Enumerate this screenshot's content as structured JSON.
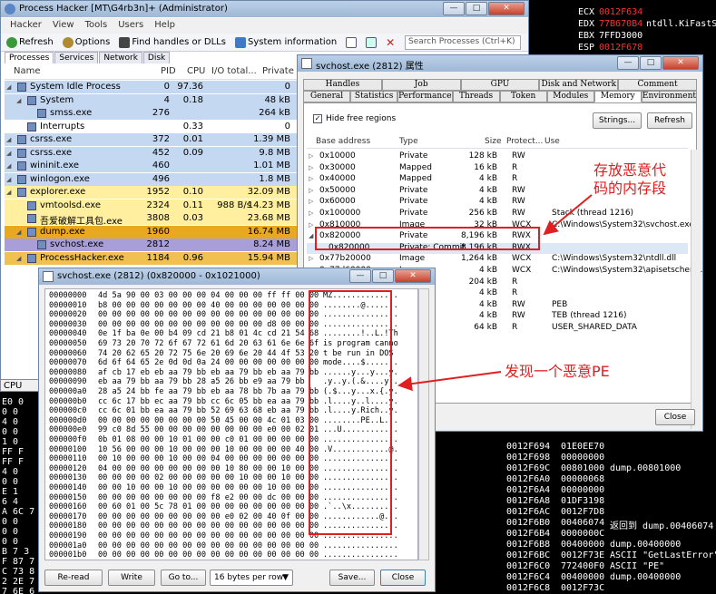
{
  "debugger": {
    "registers": [
      {
        "name": "ECX",
        "value": "0012F634",
        "note": ""
      },
      {
        "name": "EDX",
        "value": "77B670B4",
        "note": "ntdll.KiFastS"
      },
      {
        "name": "EBX",
        "value": "7FFD3000",
        "note": ""
      },
      {
        "name": "ESP",
        "value": "0012F678",
        "note": ""
      }
    ],
    "left_dump": [
      "E0 0",
      "0 0",
      "4 0",
      "0 0",
      "1 0",
      "FF F",
      "FF F",
      "4 0",
      "0 0",
      "E 1",
      "6 4",
      "A 6C 7",
      "0 0",
      "0 0",
      "0 0",
      "B 7 3",
      "F 87 7",
      "C 73 8",
      "2 2E 7",
      "7 6E 6",
      "2 7 5"
    ],
    "stack": [
      {
        "addr": "0012F694",
        "val": "01E0EE70",
        "comment": ""
      },
      {
        "addr": "0012F698",
        "val": "00000000",
        "comment": ""
      },
      {
        "addr": "0012F69C",
        "val": "00801000",
        "comment": "dump.00801000"
      },
      {
        "addr": "0012F6A0",
        "val": "00000068",
        "comment": ""
      },
      {
        "addr": "0012F6A4",
        "val": "00000000",
        "comment": ""
      },
      {
        "addr": "0012F6A8",
        "val": "01DF3198",
        "comment": ""
      },
      {
        "addr": "0012F6AC",
        "val": "0012F7D8",
        "comment": ""
      },
      {
        "addr": "0012F6B0",
        "val": "00406074",
        "comment": "返回到 dump.00406074"
      },
      {
        "addr": "0012F6B4",
        "val": "0000000C",
        "comment": ""
      },
      {
        "addr": "0012F6B8",
        "val": "00400000",
        "comment": "dump.00400000"
      },
      {
        "addr": "0012F6BC",
        "val": "0012F73E",
        "comment": "ASCII \"GetLastError\""
      },
      {
        "addr": "0012F6C0",
        "val": "772400F0",
        "comment": "ASCII \"PE\""
      },
      {
        "addr": "0012F6C4",
        "val": "00400000",
        "comment": "dump.00400000"
      },
      {
        "addr": "0012F6C8",
        "val": "0012F73C",
        "comment": ""
      }
    ]
  },
  "ph": {
    "title": "Process Hacker [MT\\G4rb3n]+ (Administrator)",
    "menu": [
      "Hacker",
      "View",
      "Tools",
      "Users",
      "Help"
    ],
    "toolbar": {
      "refresh": "Refresh",
      "options": "Options",
      "find": "Find handles or DLLs",
      "sysinfo": "System information"
    },
    "search_placeholder": "Search Processes (Ctrl+K)",
    "tabs": [
      "Processes",
      "Services",
      "Network",
      "Disk"
    ],
    "columns": {
      "name": "Name",
      "pid": "PID",
      "cpu": "CPU",
      "io": "I/O total...",
      "private": "Private ..."
    },
    "processes": [
      {
        "name": "System Idle Process",
        "pid": "0",
        "cpu": "97.36",
        "io": "",
        "private": "0",
        "indent": 0,
        "color": "#c4d8f2"
      },
      {
        "name": "System",
        "pid": "4",
        "cpu": "0.18",
        "io": "",
        "private": "48 kB",
        "indent": 1,
        "color": "#c4d8f2"
      },
      {
        "name": "smss.exe",
        "pid": "276",
        "cpu": "",
        "io": "",
        "private": "264 kB",
        "indent": 2,
        "color": "#c4d8f2"
      },
      {
        "name": "Interrupts",
        "pid": "",
        "cpu": "0.33",
        "io": "",
        "private": "0",
        "indent": 1,
        "color": "#ffffff"
      },
      {
        "name": "csrss.exe",
        "pid": "372",
        "cpu": "0.01",
        "io": "",
        "private": "1.39 MB",
        "indent": 0,
        "color": "#c4d8f2"
      },
      {
        "name": "csrss.exe",
        "pid": "452",
        "cpu": "0.09",
        "io": "",
        "private": "9.8 MB",
        "indent": 0,
        "color": "#c4d8f2"
      },
      {
        "name": "wininit.exe",
        "pid": "460",
        "cpu": "",
        "io": "",
        "private": "1.01 MB",
        "indent": 0,
        "color": "#c4d8f2"
      },
      {
        "name": "winlogon.exe",
        "pid": "496",
        "cpu": "",
        "io": "",
        "private": "1.8 MB",
        "indent": 0,
        "color": "#c4d8f2"
      },
      {
        "name": "explorer.exe",
        "pid": "1952",
        "cpu": "0.10",
        "io": "",
        "private": "32.09 MB",
        "indent": 0,
        "color": "#ffef9e"
      },
      {
        "name": "vmtoolsd.exe",
        "pid": "2324",
        "cpu": "0.11",
        "io": "988 B/s",
        "private": "14.23 MB",
        "indent": 1,
        "color": "#ffef9e"
      },
      {
        "name": "吾爱破解工具包.exe",
        "pid": "3808",
        "cpu": "0.03",
        "io": "",
        "private": "23.68 MB",
        "indent": 1,
        "color": "#ffef9e"
      },
      {
        "name": "dump.exe",
        "pid": "1960",
        "cpu": "",
        "io": "",
        "private": "16.74 MB",
        "indent": 1,
        "color": "#e8a820"
      },
      {
        "name": "svchost.exe",
        "pid": "2812",
        "cpu": "",
        "io": "",
        "private": "8.24 MB",
        "indent": 2,
        "color": "#a89ed8"
      },
      {
        "name": "ProcessHacker.exe",
        "pid": "1184",
        "cpu": "0.96",
        "io": "",
        "private": "15.94 MB",
        "indent": 1,
        "color": "#f0c050"
      }
    ],
    "cpu_tab": "CPU Us"
  },
  "prop": {
    "title": "svchost.exe (2812) 属性",
    "tabs_row1": [
      "Handles",
      "Job",
      "GPU",
      "Disk and Network",
      "Comment"
    ],
    "tabs_row2": [
      "General",
      "Statistics",
      "Performance",
      "Threads",
      "Token",
      "Modules",
      "Memory",
      "Environment"
    ],
    "hide_free": "Hide free regions",
    "strings_btn": "Strings...",
    "refresh_btn": "Refresh",
    "columns": {
      "base": "Base address",
      "type": "Type",
      "size": "Size",
      "prot": "Protect...",
      "use": "Use"
    },
    "regions": [
      {
        "base": "0x10000",
        "type": "Private",
        "size": "128 kB",
        "prot": "RW",
        "use": "",
        "expander": "▷"
      },
      {
        "base": "0x30000",
        "type": "Mapped",
        "size": "16 kB",
        "prot": "R",
        "use": "",
        "expander": "▷"
      },
      {
        "base": "0x40000",
        "type": "Mapped",
        "size": "4 kB",
        "prot": "R",
        "use": "",
        "expander": "▷"
      },
      {
        "base": "0x50000",
        "type": "Private",
        "size": "4 kB",
        "prot": "RW",
        "use": "",
        "expander": "▷"
      },
      {
        "base": "0x60000",
        "type": "Private",
        "size": "4 kB",
        "prot": "RW",
        "use": "",
        "expander": "▷"
      },
      {
        "base": "0x100000",
        "type": "Private",
        "size": "256 kB",
        "prot": "RW",
        "use": "Stack (thread 1216)",
        "expander": "▷"
      },
      {
        "base": "0x810000",
        "type": "Image",
        "size": "32 kB",
        "prot": "WCX",
        "use": "C:\\Windows\\System32\\svchost.exe",
        "expander": "▷"
      },
      {
        "base": "0x820000",
        "type": "Private",
        "size": "8,196 kB",
        "prot": "RWX",
        "use": "",
        "expander": "◢"
      },
      {
        "base": "0x820000",
        "type": "Private: Commit",
        "size": "8,196 kB",
        "prot": "RWX",
        "use": "",
        "expander": ""
      },
      {
        "base": "0x77b20000",
        "type": "Image",
        "size": "1,264 kB",
        "prot": "WCX",
        "use": "C:\\Windows\\System32\\ntdll.dll",
        "expander": "▷"
      },
      {
        "base": "0x77d60000",
        "type": "Image",
        "size": "4 kB",
        "prot": "WCX",
        "use": "C:\\Windows\\System32\\apisetschem...",
        "expander": "▷"
      },
      {
        "base": "",
        "type": "",
        "size": "204 kB",
        "prot": "R",
        "use": "",
        "expander": ""
      },
      {
        "base": "",
        "type": "",
        "size": "4 kB",
        "prot": "R",
        "use": "",
        "expander": ""
      },
      {
        "base": "",
        "type": "",
        "size": "4 kB",
        "prot": "RW",
        "use": "PEB",
        "expander": ""
      },
      {
        "base": "",
        "type": "",
        "size": "4 kB",
        "prot": "RW",
        "use": "TEB (thread 1216)",
        "expander": ""
      },
      {
        "base": "",
        "type": "",
        "size": "64 kB",
        "prot": "R",
        "use": "USER_SHARED_DATA",
        "expander": ""
      }
    ],
    "close_btn": "Close"
  },
  "hex": {
    "title": "svchost.exe (2812) (0x820000 - 0x1021000)",
    "lines": [
      {
        "addr": "00000000",
        "hex": "4d 5a 90 00 03 00 00 00 04 00 00 00 ff ff 00 00",
        "ascii": "MZ.............."
      },
      {
        "addr": "00000010",
        "hex": "b8 00 00 00 00 00 00 00 40 00 00 00 00 00 00 00",
        "ascii": "........@......."
      },
      {
        "addr": "00000020",
        "hex": "00 00 00 00 00 00 00 00 00 00 00 00 00 00 00 00",
        "ascii": "................"
      },
      {
        "addr": "00000030",
        "hex": "00 00 00 00 00 00 00 00 00 00 00 00 d8 00 00 00",
        "ascii": "................"
      },
      {
        "addr": "00000040",
        "hex": "0e 1f ba 0e 00 b4 09 cd 21 b8 01 4c cd 21 54 68",
        "ascii": "........!..L.!Th"
      },
      {
        "addr": "00000050",
        "hex": "69 73 20 70 72 6f 67 72 61 6d 20 63 61 6e 6e 6f",
        "ascii": "is program canno"
      },
      {
        "addr": "00000060",
        "hex": "74 20 62 65 20 72 75 6e 20 69 6e 20 44 4f 53 20",
        "ascii": "t be run in DOS "
      },
      {
        "addr": "00000070",
        "hex": "6d 6f 64 65 2e 0d 0d 0a 24 00 00 00 00 00 00 00",
        "ascii": "mode....$......."
      },
      {
        "addr": "00000080",
        "hex": "af cb 17 eb eb aa 79 bb eb aa 79 bb eb aa 79 bb",
        "ascii": "......y...y...y."
      },
      {
        "addr": "00000090",
        "hex": "eb aa 79 bb aa 79 bb 28 a5 26 bb e9 aa 79 bb",
        "ascii": ".y..y.(.&....y.."
      },
      {
        "addr": "000000a0",
        "hex": "28 a5 24 bb fe aa 79 bb eb aa 78 bb 7b aa 79 bb",
        "ascii": "(.$...y...x.{.y."
      },
      {
        "addr": "000000b0",
        "hex": "cc 6c 17 bb ec aa 79 bb cc 6c 05 bb ea aa 79 bb",
        "ascii": ".l....y..l....y."
      },
      {
        "addr": "000000c0",
        "hex": "cc 6c 01 bb ea aa 79 bb 52 69 63 68 eb aa 79 bb",
        "ascii": ".l....y.Rich..y."
      },
      {
        "addr": "000000d0",
        "hex": "00 00 00 00 00 00 00 00 50 45 00 00 4c 01 03 00",
        "ascii": "........PE..L..."
      },
      {
        "addr": "000000e0",
        "hex": "99 c0 8d 55 00 00 00 00 00 00 00 00 e0 00 02 01",
        "ascii": "...U............"
      },
      {
        "addr": "000000f0",
        "hex": "0b 01 08 00 00 10 01 00 00 c0 01 00 00 00 00 00",
        "ascii": "................"
      },
      {
        "addr": "00000100",
        "hex": "10 56 00 00 00 10 00 00 00 10 00 00 00 00 40 00",
        "ascii": ".V............@."
      },
      {
        "addr": "00000110",
        "hex": "00 10 00 00 00 10 00 00 04 00 00 00 00 00 00 00",
        "ascii": "................"
      },
      {
        "addr": "00000120",
        "hex": "04 00 00 00 00 00 00 00 00 10 80 00 00 10 00 00",
        "ascii": "................"
      },
      {
        "addr": "00000130",
        "hex": "00 00 00 00 02 00 00 00 00 00 10 00 00 10 00 00",
        "ascii": "................"
      },
      {
        "addr": "00000140",
        "hex": "00 00 10 00 00 10 00 00 00 00 00 00 10 00 00 00",
        "ascii": "................"
      },
      {
        "addr": "00000150",
        "hex": "00 00 00 00 00 00 00 00 f8 e2 00 00 dc 00 00 00",
        "ascii": "................"
      },
      {
        "addr": "00000160",
        "hex": "00 60 01 00 5c 78 01 00 00 00 00 00 00 00 00 00",
        "ascii": ".`..\\x.........."
      },
      {
        "addr": "00000170",
        "hex": "00 00 00 00 00 00 00 00 00 e0 02 00 40 0f 00 00",
        "ascii": "............@..."
      },
      {
        "addr": "00000180",
        "hex": "00 00 00 00 00 00 00 00 00 00 00 00 00 00 00 00",
        "ascii": "................"
      },
      {
        "addr": "00000190",
        "hex": "00 00 00 00 00 00 00 00 00 00 00 00 00 00 00 00",
        "ascii": "................"
      },
      {
        "addr": "000001a0",
        "hex": "00 00 00 00 00 00 00 00 00 00 00 00 00 00 00 00",
        "ascii": "................"
      },
      {
        "addr": "000001b0",
        "hex": "00 00 00 00 00 00 00 00 00 00 00 00 00 00 00 00",
        "ascii": "................"
      }
    ],
    "buttons": {
      "reread": "Re-read",
      "write": "Write",
      "goto": "Go to...",
      "rowsize": "16 bytes per row",
      "save": "Save...",
      "close": "Close"
    }
  },
  "annotations": {
    "mem_note": "存放恶意代\n码的内存段",
    "pe_note": "发现一个恶意PE"
  },
  "colors": {
    "annotation_red": "#e02020",
    "register_red": "#ff3030"
  }
}
